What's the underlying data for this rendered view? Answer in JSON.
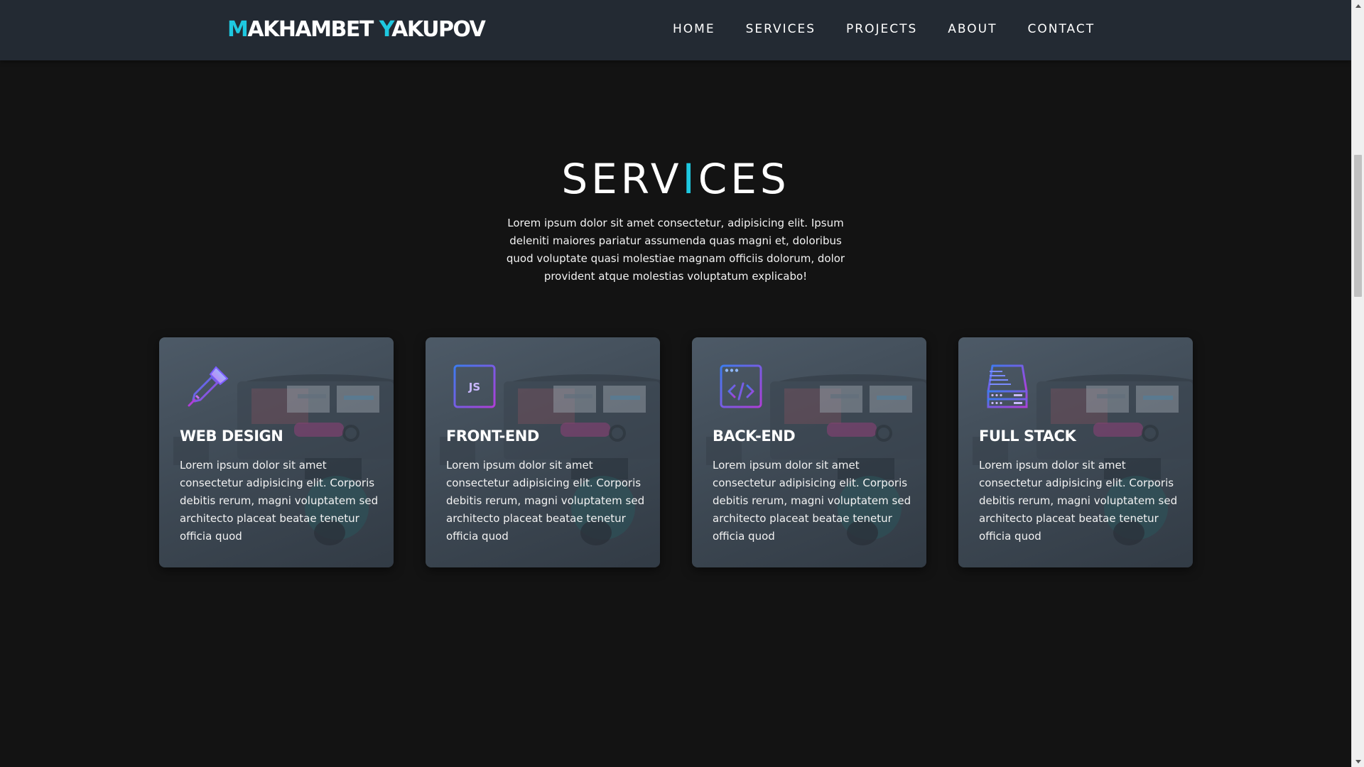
{
  "nav": {
    "logo_first_initial": "M",
    "logo_first_rest": "AKHAMBET ",
    "logo_last_initial": "Y",
    "logo_last_rest": "AKUPOV",
    "links": [
      {
        "label": "HOME"
      },
      {
        "label": "SERVICES"
      },
      {
        "label": "PROJECTS"
      },
      {
        "label": "ABOUT"
      },
      {
        "label": "CONTACT"
      }
    ]
  },
  "services": {
    "title_part1": "SERV",
    "title_accent": "I",
    "title_part2": "CES",
    "intro": "Lorem ipsum dolor sit amet consectetur, adipisicing elit. Ipsum deleniti maiores pariatur assumenda quas magni et, doloribus quod voluptate quasi molestiae magnam officiis dolorum, dolor provident atque molestias voluptatum explicabo!",
    "cards": [
      {
        "title": "WEB DESIGN",
        "icon": "pen-tool-icon",
        "text": "Lorem ipsum dolor sit amet consectetur adipisicing elit. Corporis debitis rerum, magni voluptatem sed architecto placeat beatae tenetur officia quod"
      },
      {
        "title": "FRONT-END",
        "icon": "js-icon",
        "icon_text": "JS",
        "text": "Lorem ipsum dolor sit amet consectetur adipisicing elit. Corporis debitis rerum, magni voluptatem sed architecto placeat beatae tenetur officia quod"
      },
      {
        "title": "BACK-END",
        "icon": "code-window-icon",
        "text": "Lorem ipsum dolor sit amet consectetur adipisicing elit. Corporis debitis rerum, magni voluptatem sed architecto placeat beatae tenetur officia quod"
      },
      {
        "title": "FULL STACK",
        "icon": "server-stack-icon",
        "text": "Lorem ipsum dolor sit amet consectetur adipisicing elit. Corporis debitis rerum, magni voluptatem sed architecto placeat beatae tenetur officia quod"
      }
    ]
  },
  "colors": {
    "accent": "#1ec8e0",
    "navbar": "#232a33",
    "background": "#131313",
    "icon_gradient_start": "#3d7cf0",
    "icon_gradient_end": "#b03ed8"
  }
}
